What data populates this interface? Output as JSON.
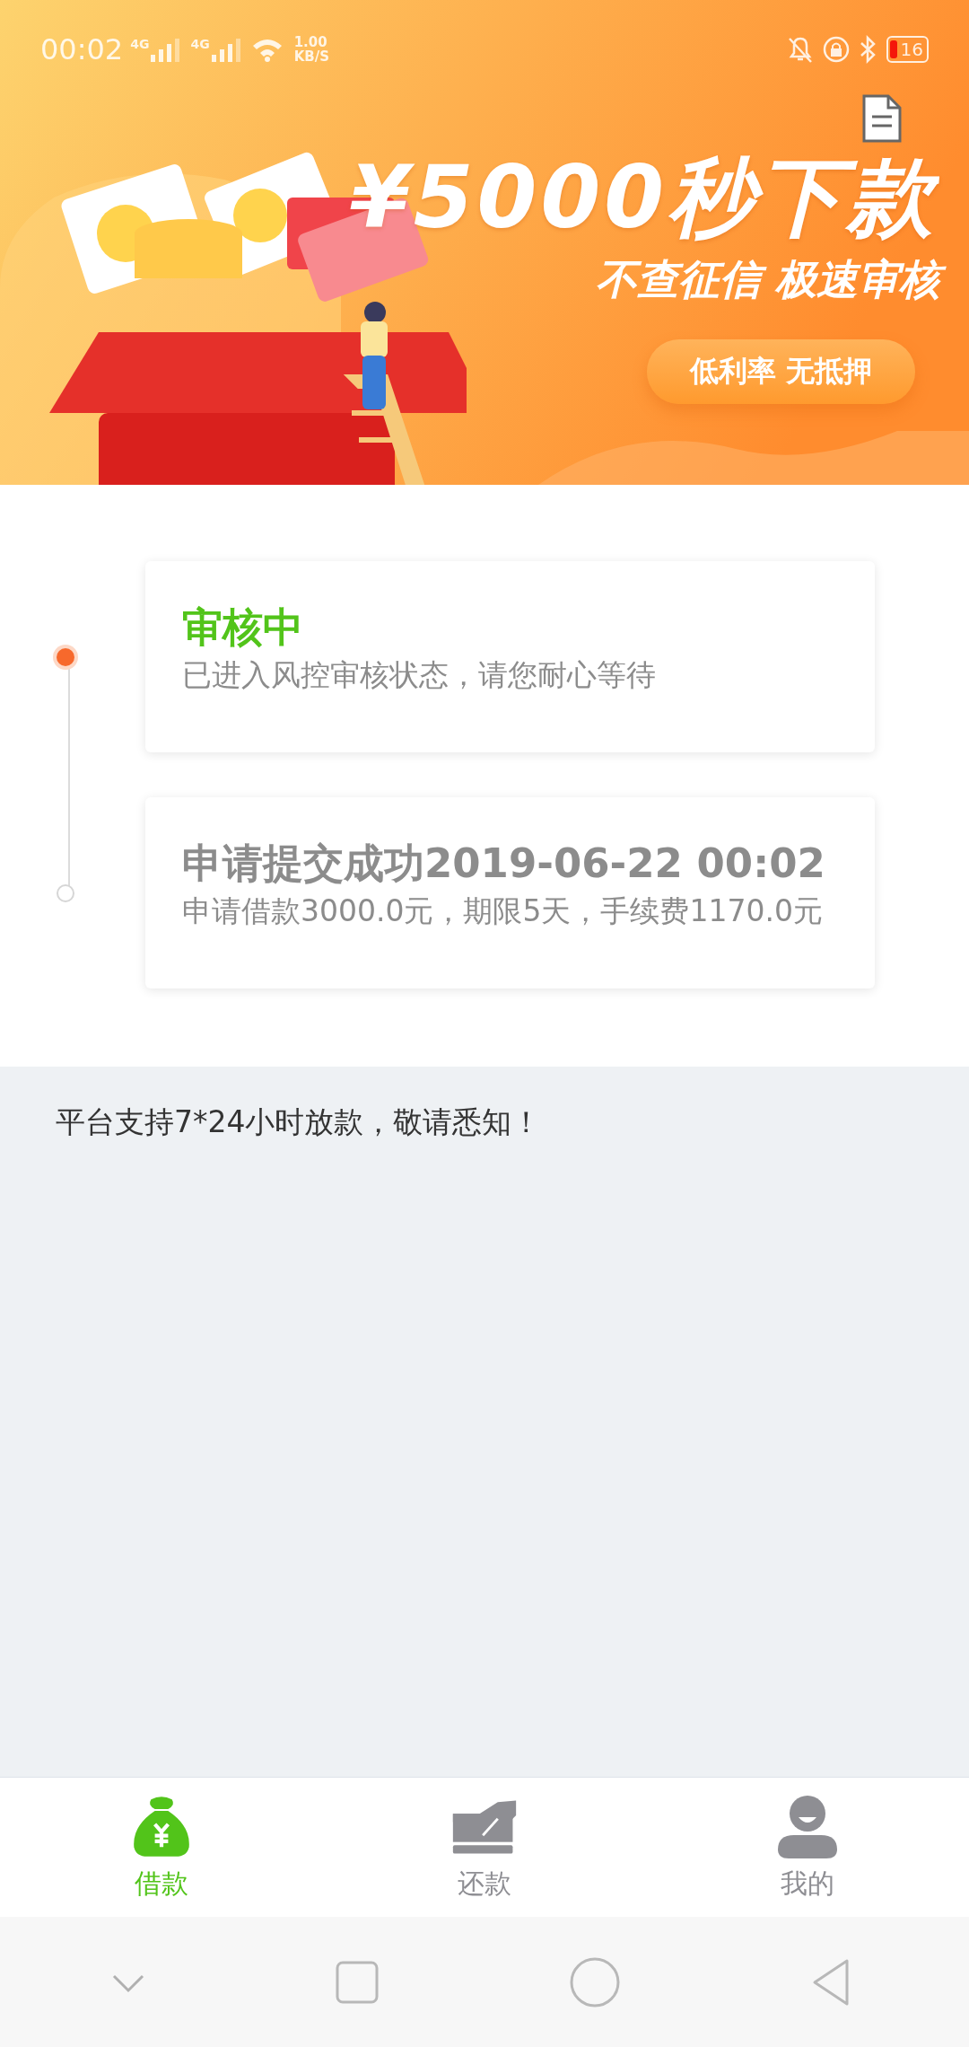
{
  "status_bar": {
    "time": "00:02",
    "network_1": "4G",
    "network_2": "4G",
    "speed_value": "1.00",
    "speed_unit": "KB/S",
    "battery": "16"
  },
  "banner": {
    "title": "¥5000秒下款",
    "subtitle": "不查征信 极速审核",
    "pill": "低利率 无抵押"
  },
  "timeline": [
    {
      "title": "审核中",
      "detail": "已进入风控审核状态，请您耐心等待",
      "current": true
    },
    {
      "title": "申请提交成功2019-06-22 00:02",
      "detail": "申请借款3000.0元，期限5天，手续费1170.0元",
      "current": false
    }
  ],
  "notice": "平台支持7*24小时放款，敬请悉知！",
  "tabs": [
    {
      "label": "借款",
      "kind": "loan",
      "selected": true
    },
    {
      "label": "还款",
      "kind": "repay",
      "selected": false
    },
    {
      "label": "我的",
      "kind": "profile",
      "selected": false
    }
  ]
}
